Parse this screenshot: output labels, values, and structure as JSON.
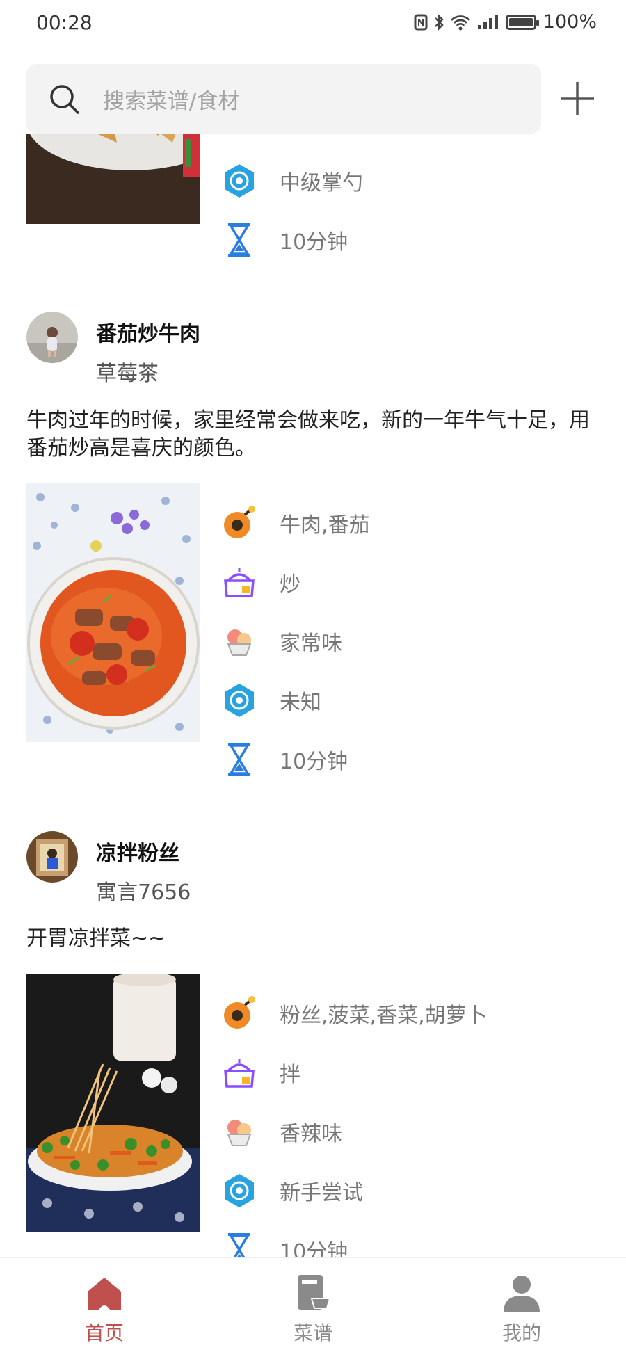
{
  "status_bar": {
    "time": "00:28",
    "battery": "100%"
  },
  "search": {
    "placeholder": "搜索菜谱/食材"
  },
  "colors": {
    "accent": "#c0504d",
    "inactive": "#8a8a8a",
    "skill_icon": "#29a3e0",
    "time_icon": "#2a7de1",
    "ingredient_icon": "#f08a24",
    "method_icon": "#8a4dff"
  },
  "feed": [
    {
      "attributes": [
        {
          "icon": "skill-level-icon",
          "text": "中级掌勺"
        },
        {
          "icon": "hourglass-icon",
          "text": "10分钟"
        }
      ]
    },
    {
      "title": "番茄炒牛肉",
      "author": "草莓茶",
      "description": "牛肉过年的时候，家里经常会做来吃，新的一年牛气十足，用番茄炒高是喜庆的颜色。",
      "attributes": [
        {
          "icon": "ingredient-icon",
          "text": "牛肉,番茄"
        },
        {
          "icon": "cooking-method-icon",
          "text": "炒"
        },
        {
          "icon": "flavor-icon",
          "text": "家常味"
        },
        {
          "icon": "skill-level-icon",
          "text": "未知"
        },
        {
          "icon": "hourglass-icon",
          "text": "10分钟"
        }
      ]
    },
    {
      "title": "凉拌粉丝",
      "author": "寓言7656",
      "description": "开胃凉拌菜~~",
      "attributes": [
        {
          "icon": "ingredient-icon",
          "text": "粉丝,菠菜,香菜,胡萝卜"
        },
        {
          "icon": "cooking-method-icon",
          "text": "拌"
        },
        {
          "icon": "flavor-icon",
          "text": "香辣味"
        },
        {
          "icon": "skill-level-icon",
          "text": "新手尝试"
        },
        {
          "icon": "hourglass-icon",
          "text": "10分钟"
        }
      ]
    }
  ],
  "bottom_nav": [
    {
      "label": "首页",
      "icon": "home-icon",
      "active": true
    },
    {
      "label": "菜谱",
      "icon": "recipe-book-icon",
      "active": false
    },
    {
      "label": "我的",
      "icon": "profile-icon",
      "active": false
    }
  ]
}
